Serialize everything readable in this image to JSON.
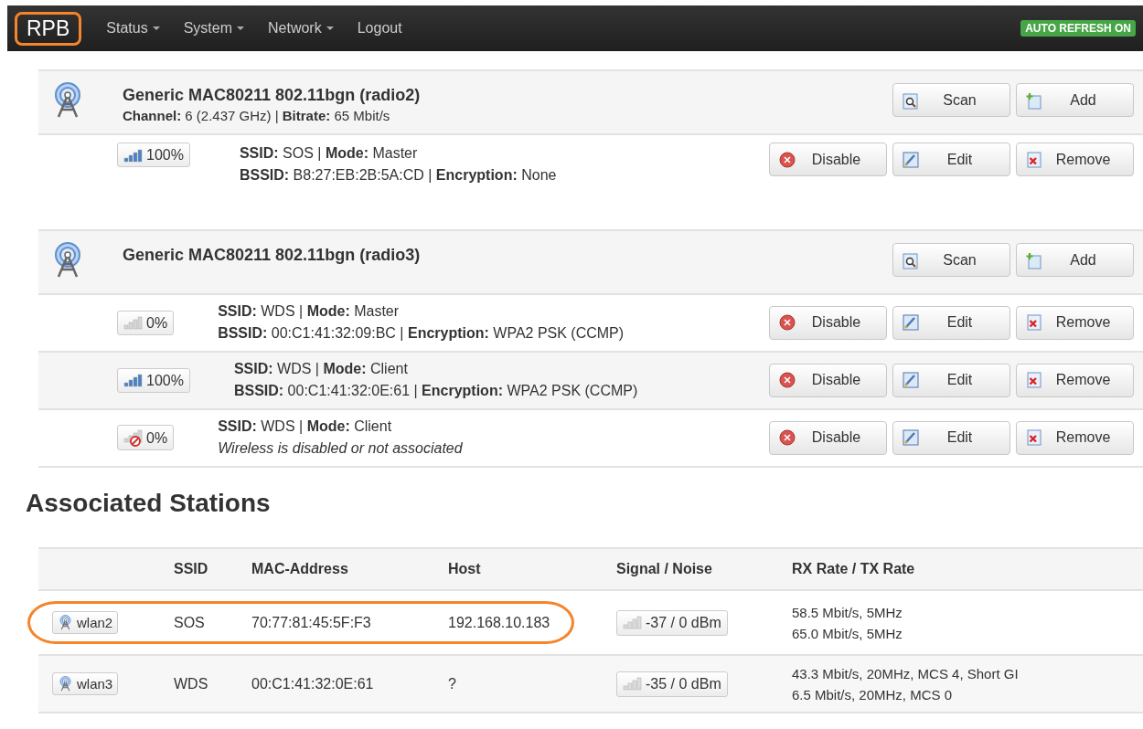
{
  "nav": {
    "brand": "RPB",
    "brand_highlighted": true,
    "menus": [
      {
        "label": "Status",
        "dropdown": true
      },
      {
        "label": "System",
        "dropdown": true
      },
      {
        "label": "Network",
        "dropdown": true
      },
      {
        "label": "Logout",
        "dropdown": false
      }
    ],
    "badge": "AUTO REFRESH ON"
  },
  "radios": [
    {
      "title": "Generic MAC80211 802.11bgn (radio2)",
      "info": "**Channel:** 6 (2.437 GHz) | **Bitrate:** 65 Mbit/s",
      "buttons": [
        {
          "label": "Scan",
          "kind": "scan"
        },
        {
          "label": "Add",
          "kind": "add"
        }
      ],
      "networks": [
        {
          "kind": "full",
          "quality": "100%",
          "line1": "**SSID:** SOS | **Mode:** Master",
          "line2": "**BSSID:** B8:27:EB:2B:5A:CD | **Encryption:** None",
          "buttons": [
            {
              "label": "Disable",
              "kind": "disable"
            },
            {
              "label": "Edit",
              "kind": "edit"
            },
            {
              "label": "Remove",
              "kind": "remove"
            }
          ]
        }
      ]
    },
    {
      "title": "Generic MAC80211 802.11bgn (radio3)",
      "buttons": [
        {
          "label": "Scan",
          "kind": "scan"
        },
        {
          "label": "Add",
          "kind": "add"
        }
      ],
      "networks": [
        {
          "kind": "empty",
          "quality": "0%",
          "line1": "**SSID:** WDS | **Mode:** Master",
          "line2": "**BSSID:** 00:C1:41:32:09:BC | **Encryption:** WPA2 PSK (CCMP)",
          "buttons": [
            {
              "label": "Disable",
              "kind": "disable"
            },
            {
              "label": "Edit",
              "kind": "edit"
            },
            {
              "label": "Remove",
              "kind": "remove"
            }
          ]
        },
        {
          "kind": "full",
          "quality": "100%",
          "line1": "**SSID:** WDS | **Mode:** Client",
          "line2": "**BSSID:** 00:C1:41:32:0E:61 | **Encryption:** WPA2 PSK (CCMP)",
          "buttons": [
            {
              "label": "Disable",
              "kind": "disable"
            },
            {
              "label": "Edit",
              "kind": "edit"
            },
            {
              "label": "Remove",
              "kind": "remove"
            }
          ]
        },
        {
          "kind": "disabled",
          "quality": "0%",
          "line1": "**SSID:** WDS | **Mode:** Client",
          "note": "Wireless is disabled or not associated",
          "buttons": [
            {
              "label": "Disable",
              "kind": "disable"
            },
            {
              "label": "Edit",
              "kind": "edit"
            },
            {
              "label": "Remove",
              "kind": "remove"
            }
          ]
        }
      ]
    }
  ],
  "stations": {
    "heading": "Associated Stations",
    "columns": [
      "SSID",
      "MAC-Address",
      "Host",
      "Signal / Noise",
      "RX Rate / TX Rate"
    ],
    "rows": [
      {
        "iface": "wlan2",
        "ssid": "SOS",
        "mac": "70:77:81:45:5F:F3",
        "host": "192.168.10.183",
        "signal": "-37 / 0 dBm",
        "rx": "58.5 Mbit/s, 5MHz",
        "tx": "65.0 Mbit/s, 5MHz",
        "highlighted": true
      },
      {
        "iface": "wlan3",
        "ssid": "WDS",
        "mac": "00:C1:41:32:0E:61",
        "host": "?",
        "signal": "-35 / 0 dBm",
        "rx": "43.3 Mbit/s, 20MHz, MCS 4, Short GI",
        "tx": "6.5 Mbit/s, 20MHz, MCS 0",
        "highlighted": false
      }
    ]
  }
}
